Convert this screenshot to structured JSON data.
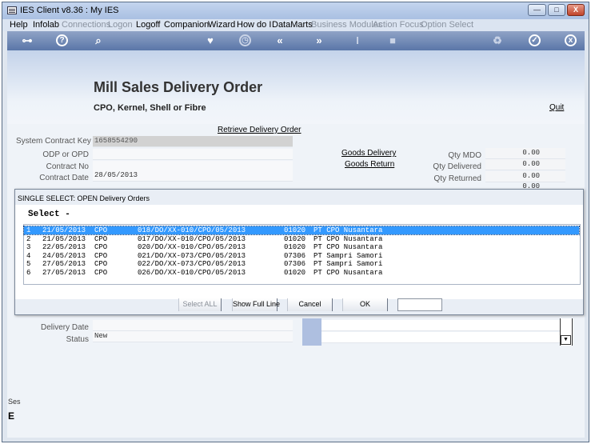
{
  "window": {
    "title": "IES Client v8.36 : My IES",
    "minimize": "—",
    "maximize": "□",
    "close": "X"
  },
  "menu": [
    {
      "label": "Help",
      "enabled": true
    },
    {
      "label": "Infolab",
      "enabled": true
    },
    {
      "label": "Connections",
      "enabled": false
    },
    {
      "label": "Logon",
      "enabled": false
    },
    {
      "label": "Logoff",
      "enabled": true
    },
    {
      "label": "Companion",
      "enabled": true
    },
    {
      "label": "Wizard",
      "enabled": true
    },
    {
      "label": "How do I",
      "enabled": true
    },
    {
      "label": "DataMarts",
      "enabled": true
    },
    {
      "label": "Business Modules",
      "enabled": false
    },
    {
      "label": "Action Focus",
      "enabled": false
    },
    {
      "label": "Option Select",
      "enabled": false
    }
  ],
  "toolbar": {
    "key_icon": "⊶",
    "help_icon": "?",
    "search_icon": "⌕",
    "favorite_icon": "♥",
    "history_icon": "◷",
    "back_icon": "«",
    "forward_icon": "»",
    "text_icon": "I",
    "stop_icon": "■",
    "recycle_icon": "♻",
    "ok_icon": "✓",
    "close_icon": "x"
  },
  "page": {
    "title": "Mill Sales Delivery Order",
    "subtitle": "CPO, Kernel, Shell or Fibre",
    "quit": "Quit",
    "retrieve_link": "Retrieve Delivery Order",
    "goods_delivery": "Goods Delivery",
    "goods_return": "Goods Return"
  },
  "form": {
    "system_contract_key_label": "System Contract Key",
    "system_contract_key": "1658554290",
    "odp_label": "ODP or OPD",
    "odp_value": "",
    "contract_no_label": "Contract No",
    "contract_no": "",
    "contract_date_label": "Contract Date",
    "contract_date": "28/05/2013",
    "qty_mdo_label": "Qty MDO",
    "qty_mdo": "0.00",
    "qty_delivered_label": "Qty Delivered",
    "qty_delivered": "0.00",
    "qty_returned_label": "Qty Returned",
    "qty_returned": "0.00",
    "qty_extra": "0.00",
    "delivery_date_label": "Delivery Date",
    "delivery_date": "",
    "status_label": "Status",
    "status": "New",
    "dropdown_arrow": "▼"
  },
  "dialog": {
    "title": "SINGLE SELECT: OPEN Delivery Orders",
    "select_label": "Select -",
    "rows": [
      {
        "n": "1",
        "date": "21/05/2013",
        "type": "CPO",
        "ref": "018/DO/XX-010/CPO/05/2013",
        "code": "01020",
        "name": "PT CPO Nusantara"
      },
      {
        "n": "2",
        "date": "21/05/2013",
        "type": "CPO",
        "ref": "017/DO/XX-010/CPO/05/2013",
        "code": "01020",
        "name": "PT CPO Nusantara"
      },
      {
        "n": "3",
        "date": "22/05/2013",
        "type": "CPO",
        "ref": "020/DO/XX-010/CPO/05/2013",
        "code": "01020",
        "name": "PT CPO Nusantara"
      },
      {
        "n": "4",
        "date": "24/05/2013",
        "type": "CPO",
        "ref": "021/DO/XX-073/CPO/05/2013",
        "code": "07306",
        "name": "PT Sampri Samori"
      },
      {
        "n": "5",
        "date": "27/05/2013",
        "type": "CPO",
        "ref": "022/DO/XX-073/CPO/05/2013",
        "code": "07306",
        "name": "PT Sampri Samori"
      },
      {
        "n": "6",
        "date": "27/05/2013",
        "type": "CPO",
        "ref": "026/DO/XX-010/CPO/05/2013",
        "code": "01020",
        "name": "PT CPO Nusantara"
      }
    ],
    "selected_row": 1,
    "select_all": "Select ALL",
    "show_full_line": "Show Full Line",
    "cancel": "Cancel",
    "ok": "OK",
    "input_value": ""
  },
  "side": {
    "text": "Ses",
    "icon": "E"
  }
}
